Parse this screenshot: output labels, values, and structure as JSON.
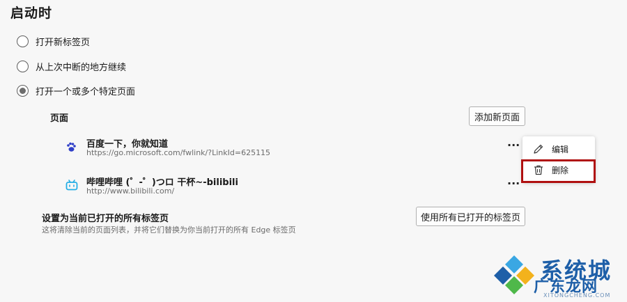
{
  "section": {
    "title": "启动时"
  },
  "startup_options": [
    {
      "label": "打开新标签页",
      "checked": false
    },
    {
      "label": "从上次中断的地方继续",
      "checked": false
    },
    {
      "label": "打开一个或多个特定页面",
      "checked": true
    }
  ],
  "pages": {
    "label": "页面",
    "add_button": "添加新页面",
    "items": [
      {
        "title": "百度一下，你就知道",
        "url": "https://go.microsoft.com/fwlink/?LinkId=625115",
        "icon": "baidu-icon",
        "more": "···"
      },
      {
        "title": "哔哩哔哩 (゜-゜)つロ 干杯~-bilibili",
        "url": "http://www.bilibili.com/",
        "icon": "bilibili-icon",
        "more": "···"
      }
    ]
  },
  "context_menu": {
    "edit": "编辑",
    "delete": "删除",
    "highlight_color": "#b01010"
  },
  "set_current": {
    "title": "设置为当前已打开的所有标签页",
    "description": "这将清除当前的页面列表，并将它们替换为你当前打开的所有 Edge 标签页",
    "button": "使用所有已打开的标签页"
  },
  "watermark": {
    "main": "系统城",
    "sub": "广东龙网",
    "url": "XITONGCHENG.COM"
  }
}
